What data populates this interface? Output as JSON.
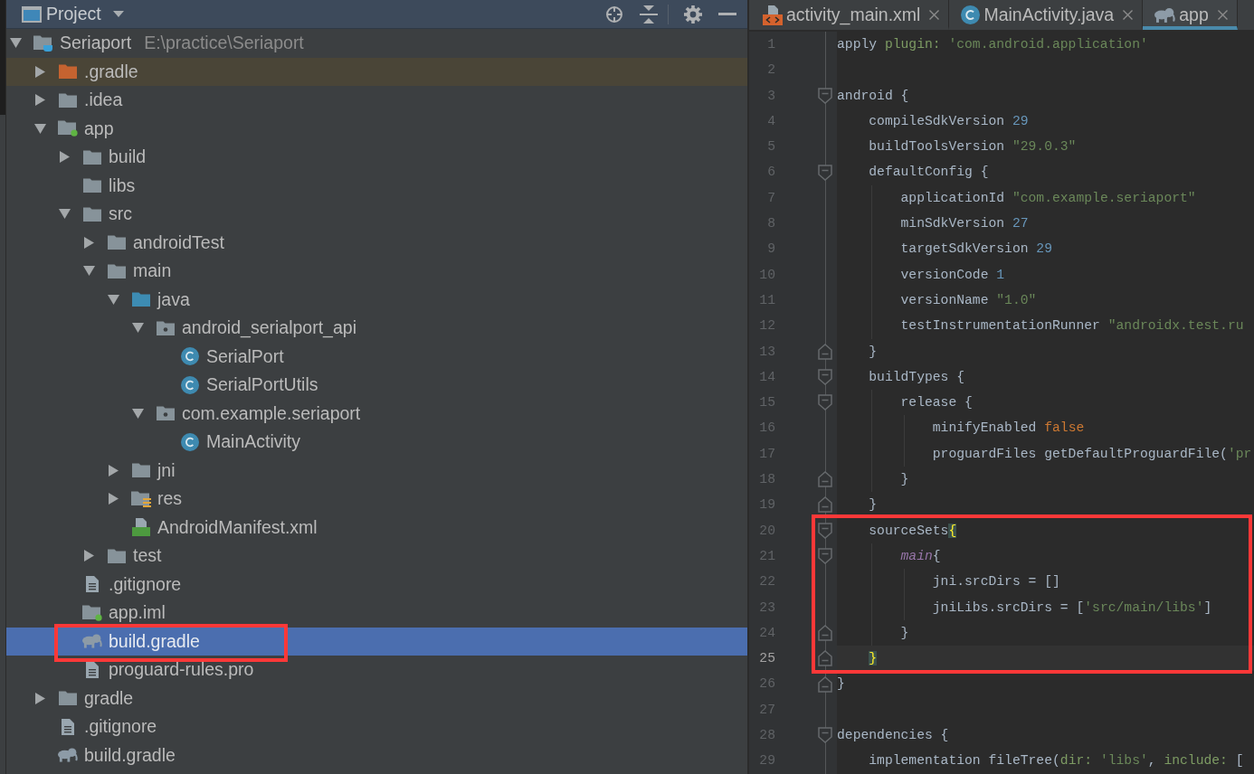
{
  "project_panel": {
    "view_title": "Project",
    "tree": [
      {
        "label": "Seriaport",
        "detail": "E:\\practice\\Seriaport",
        "kind": "project",
        "expanded": true,
        "selected": false,
        "shaded": false,
        "boxed": false,
        "children": [
          {
            "label": ".gradle",
            "kind": "excluded-folder",
            "expanded": false,
            "selected": false,
            "shaded": true,
            "boxed": false
          },
          {
            "label": ".idea",
            "kind": "folder",
            "expanded": false,
            "selected": false,
            "shaded": false,
            "boxed": false
          },
          {
            "label": "app",
            "kind": "module",
            "expanded": true,
            "selected": false,
            "shaded": false,
            "boxed": false,
            "children": [
              {
                "label": "build",
                "kind": "folder",
                "expanded": false,
                "selected": false,
                "shaded": false,
                "boxed": false
              },
              {
                "label": "libs",
                "kind": "folder",
                "selected": false,
                "shaded": false,
                "boxed": false
              },
              {
                "label": "src",
                "kind": "folder",
                "expanded": true,
                "selected": false,
                "shaded": false,
                "boxed": false,
                "children": [
                  {
                    "label": "androidTest",
                    "kind": "folder",
                    "expanded": false,
                    "selected": false,
                    "shaded": false,
                    "boxed": false
                  },
                  {
                    "label": "main",
                    "kind": "folder",
                    "expanded": true,
                    "selected": false,
                    "shaded": false,
                    "boxed": false,
                    "children": [
                      {
                        "label": "java",
                        "kind": "source-folder",
                        "expanded": true,
                        "selected": false,
                        "shaded": false,
                        "boxed": false,
                        "children": [
                          {
                            "label": "android_serialport_api",
                            "kind": "package",
                            "expanded": true,
                            "selected": false,
                            "shaded": false,
                            "boxed": false,
                            "children": [
                              {
                                "label": "SerialPort",
                                "kind": "class",
                                "selected": false,
                                "shaded": false,
                                "boxed": false
                              },
                              {
                                "label": "SerialPortUtils",
                                "kind": "class",
                                "selected": false,
                                "shaded": false,
                                "boxed": false
                              }
                            ]
                          },
                          {
                            "label": "com.example.seriaport",
                            "kind": "package",
                            "expanded": true,
                            "selected": false,
                            "shaded": false,
                            "boxed": false,
                            "children": [
                              {
                                "label": "MainActivity",
                                "kind": "class",
                                "selected": false,
                                "shaded": false,
                                "boxed": false
                              }
                            ]
                          }
                        ]
                      },
                      {
                        "label": "jni",
                        "kind": "folder",
                        "expanded": false,
                        "selected": false,
                        "shaded": false,
                        "boxed": false
                      },
                      {
                        "label": "res",
                        "kind": "resources-folder",
                        "expanded": false,
                        "selected": false,
                        "shaded": false,
                        "boxed": false
                      },
                      {
                        "label": "AndroidManifest.xml",
                        "kind": "manifest",
                        "selected": false,
                        "shaded": false,
                        "boxed": false
                      }
                    ]
                  },
                  {
                    "label": "test",
                    "kind": "folder",
                    "expanded": false,
                    "selected": false,
                    "shaded": false,
                    "boxed": false
                  }
                ]
              },
              {
                "label": ".gitignore",
                "kind": "text-file",
                "selected": false,
                "shaded": false,
                "boxed": false
              },
              {
                "label": "app.iml",
                "kind": "module",
                "selected": false,
                "shaded": false,
                "boxed": false
              },
              {
                "label": "build.gradle",
                "kind": "gradle",
                "selected": true,
                "shaded": false,
                "boxed": true
              },
              {
                "label": "proguard-rules.pro",
                "kind": "text-file",
                "selected": false,
                "shaded": false,
                "boxed": false
              }
            ]
          },
          {
            "label": "gradle",
            "kind": "folder",
            "expanded": false,
            "selected": false,
            "shaded": false,
            "boxed": false
          },
          {
            "label": ".gitignore",
            "kind": "text-file",
            "selected": false,
            "shaded": false,
            "boxed": false
          },
          {
            "label": "build.gradle",
            "kind": "gradle",
            "selected": false,
            "shaded": false,
            "boxed": false
          }
        ]
      }
    ]
  },
  "editor": {
    "tabs": [
      {
        "label": "activity_main.xml",
        "kind": "xml",
        "selected": false
      },
      {
        "label": "MainActivity.java",
        "kind": "class",
        "selected": false
      },
      {
        "label": "app",
        "kind": "gradle",
        "selected": true
      }
    ],
    "blocks": [
      {
        "lines": [
          {
            "number": "1",
            "kind": "plain",
            "segments": [
              {
                "text": "apply ",
                "kind": "plain"
              },
              {
                "text": "plugin: ",
                "kind": "label"
              },
              {
                "text": "'com.android.application'",
                "kind": "string"
              }
            ],
            "current": false
          },
          {
            "number": "2",
            "kind": "plain",
            "current": false
          },
          {
            "number": "3",
            "kind": "opener",
            "segments": [
              {
                "text": "android {",
                "kind": "plain"
              }
            ],
            "current": false
          },
          {
            "number": "4",
            "kind": "plain",
            "segments": [
              {
                "text": "    compileSdkVersion ",
                "kind": "plain"
              },
              {
                "text": "29",
                "kind": "number"
              }
            ],
            "current": false
          },
          {
            "number": "5",
            "kind": "plain",
            "segments": [
              {
                "text": "    buildToolsVersion ",
                "kind": "plain"
              },
              {
                "text": "\"29.0.3\"",
                "kind": "string"
              }
            ],
            "current": false
          },
          {
            "number": "6",
            "kind": "opener",
            "segments": [
              {
                "text": "    defaultConfig {",
                "kind": "plain"
              }
            ],
            "current": false
          },
          {
            "number": "7",
            "kind": "plain",
            "segments": [
              {
                "text": "        applicationId ",
                "kind": "plain"
              },
              {
                "text": "\"com.example.seriaport\"",
                "kind": "string"
              }
            ],
            "current": false
          },
          {
            "number": "8",
            "kind": "plain",
            "segments": [
              {
                "text": "        minSdkVersion ",
                "kind": "plain"
              },
              {
                "text": "27",
                "kind": "number"
              }
            ],
            "current": false
          },
          {
            "number": "9",
            "kind": "plain",
            "segments": [
              {
                "text": "        targetSdkVersion ",
                "kind": "plain"
              },
              {
                "text": "29",
                "kind": "number"
              }
            ],
            "current": false
          },
          {
            "number": "10",
            "kind": "plain",
            "segments": [
              {
                "text": "        versionCode ",
                "kind": "plain"
              },
              {
                "text": "1",
                "kind": "number"
              }
            ],
            "current": false
          },
          {
            "number": "11",
            "kind": "plain",
            "segments": [
              {
                "text": "        versionName ",
                "kind": "plain"
              },
              {
                "text": "\"1.0\"",
                "kind": "string"
              }
            ],
            "current": false
          },
          {
            "number": "12",
            "kind": "plain",
            "segments": [
              {
                "text": "        testInstrumentationRunner ",
                "kind": "plain"
              },
              {
                "text": "\"androidx.test.ru",
                "kind": "string"
              }
            ],
            "current": false
          },
          {
            "number": "13",
            "kind": "closer",
            "segments": [
              {
                "text": "    }",
                "kind": "plain"
              }
            ],
            "current": false
          },
          {
            "number": "14",
            "kind": "opener",
            "segments": [
              {
                "text": "    buildTypes {",
                "kind": "plain"
              }
            ],
            "current": false
          },
          {
            "number": "15",
            "kind": "opener",
            "segments": [
              {
                "text": "        release {",
                "kind": "plain"
              }
            ],
            "current": false
          },
          {
            "number": "16",
            "kind": "plain",
            "segments": [
              {
                "text": "            minifyEnabled ",
                "kind": "plain"
              },
              {
                "text": "false",
                "kind": "keyword"
              }
            ],
            "current": false
          },
          {
            "number": "17",
            "kind": "plain",
            "segments": [
              {
                "text": "            proguardFiles getDefaultProguardFile(",
                "kind": "plain"
              },
              {
                "text": "'pr",
                "kind": "string"
              }
            ],
            "current": false
          },
          {
            "number": "18",
            "kind": "closer",
            "segments": [
              {
                "text": "        }",
                "kind": "plain"
              }
            ],
            "current": false
          },
          {
            "number": "19",
            "kind": "closer",
            "segments": [
              {
                "text": "    }",
                "kind": "plain"
              }
            ],
            "current": false
          }
        ]
      },
      {
        "framed": true,
        "lines": [
          {
            "number": "20",
            "kind": "opener",
            "segments": [
              {
                "text": "    sourceSets",
                "kind": "plain"
              },
              {
                "text": "{",
                "kind": "brace"
              }
            ],
            "current": false
          },
          {
            "number": "21",
            "kind": "opener",
            "segments": [
              {
                "text": "        main",
                "kind": "field"
              },
              {
                "text": "{",
                "kind": "plain"
              }
            ],
            "current": false
          },
          {
            "number": "22",
            "kind": "plain",
            "segments": [
              {
                "text": "            jni.srcDirs = []",
                "kind": "plain"
              }
            ],
            "current": false
          },
          {
            "number": "23",
            "kind": "plain",
            "segments": [
              {
                "text": "            jniLibs.srcDirs = [",
                "kind": "plain"
              },
              {
                "text": "'src/main/libs'",
                "kind": "string"
              },
              {
                "text": "]",
                "kind": "plain"
              }
            ],
            "current": false
          },
          {
            "number": "24",
            "kind": "closer",
            "segments": [
              {
                "text": "        }",
                "kind": "plain"
              }
            ],
            "current": false
          },
          {
            "number": "25",
            "kind": "closer",
            "segments": [
              {
                "text": "    }",
                "kind": "brace"
              }
            ],
            "current": true
          }
        ]
      },
      {
        "lines": [
          {
            "number": "26",
            "kind": "closer",
            "segments": [
              {
                "text": "}",
                "kind": "plain"
              }
            ],
            "current": false
          },
          {
            "number": "27",
            "kind": "plain",
            "current": false
          },
          {
            "number": "28",
            "kind": "opener",
            "segments": [
              {
                "text": "dependencies {",
                "kind": "plain"
              }
            ],
            "current": false
          },
          {
            "number": "29",
            "kind": "plain",
            "segments": [
              {
                "text": "    implementation fileTree(",
                "kind": "plain"
              },
              {
                "text": "dir: ",
                "kind": "label"
              },
              {
                "text": "'libs'",
                "kind": "string"
              },
              {
                "text": ", ",
                "kind": "plain"
              },
              {
                "text": "include: ",
                "kind": "label"
              },
              {
                "text": "[",
                "kind": "plain"
              }
            ],
            "current": false
          }
        ]
      }
    ]
  }
}
